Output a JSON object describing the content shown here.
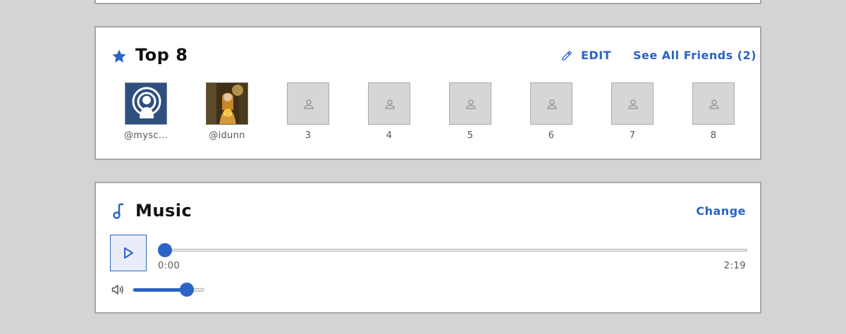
{
  "colors": {
    "accent": "#2b63c6",
    "background": "#d4d4d4",
    "card_border": "#a6a6a6"
  },
  "top8": {
    "title": "Top 8",
    "icon": "star-icon",
    "edit_label": "EDIT",
    "see_all_label": "See All Friends (2)",
    "friends": [
      {
        "label": "@mysc…",
        "kind": "podcast-avatar"
      },
      {
        "label": "@idunn",
        "kind": "photo-avatar"
      },
      {
        "label": "3",
        "kind": "empty"
      },
      {
        "label": "4",
        "kind": "empty"
      },
      {
        "label": "5",
        "kind": "empty"
      },
      {
        "label": "6",
        "kind": "empty"
      },
      {
        "label": "7",
        "kind": "empty"
      },
      {
        "label": "8",
        "kind": "empty"
      }
    ]
  },
  "music": {
    "title": "Music",
    "icon": "music-note-icon",
    "change_label": "Change",
    "current_time": "0:00",
    "duration": "2:19",
    "progress_fraction": 0.0,
    "volume_fraction": 0.75
  }
}
